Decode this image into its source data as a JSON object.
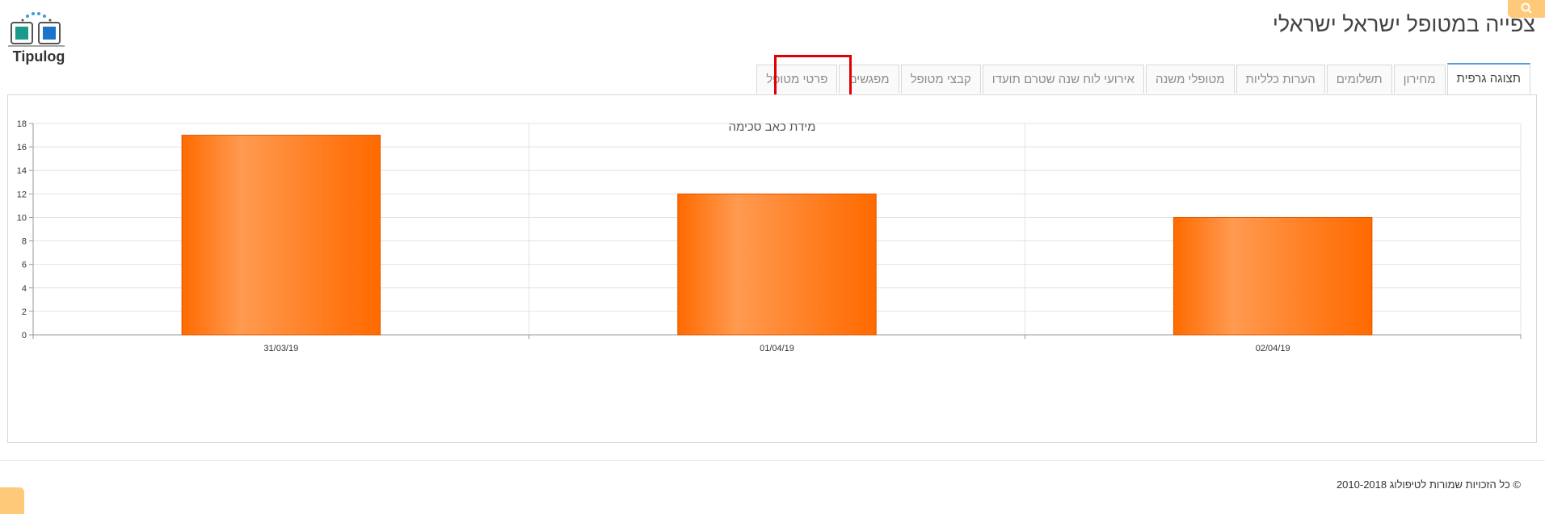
{
  "header": {
    "logo_text": "Tipulog",
    "page_title": "צפייה במטופל ישראל ישראלי"
  },
  "tabs": [
    {
      "label": "פרטי מטופל",
      "active": false
    },
    {
      "label": "מפגשים",
      "active": false
    },
    {
      "label": "קבצי מטופל",
      "active": false
    },
    {
      "label": "אירועי לוח שנה שטרם תועדו",
      "active": false
    },
    {
      "label": "מטופלי משנה",
      "active": false
    },
    {
      "label": "הערות כלליות",
      "active": false
    },
    {
      "label": "תשלומים",
      "active": false
    },
    {
      "label": "מחירון",
      "active": false
    },
    {
      "label": "תצוגה גרפית",
      "active": true
    }
  ],
  "chart_data": {
    "type": "bar",
    "title": "מידת כאב סכימה",
    "categories": [
      "31/03/19",
      "01/04/19",
      "02/04/19"
    ],
    "values": [
      17,
      12,
      10
    ],
    "ylim": [
      0,
      18
    ],
    "yticks": [
      0,
      2,
      4,
      6,
      8,
      10,
      12,
      14,
      16,
      18
    ],
    "grid": true,
    "bar_color": "#ff6a00",
    "bar_highlight": "#ff9a50"
  },
  "footer": {
    "copyright": "© כל הזכויות שמורות לטיפולוג 2010-2018"
  },
  "colors": {
    "accent": "#ffc97a",
    "highlight_frame": "#e00000",
    "active_tab_border": "#5b9bd5"
  },
  "icons": {
    "search": "search-icon"
  }
}
